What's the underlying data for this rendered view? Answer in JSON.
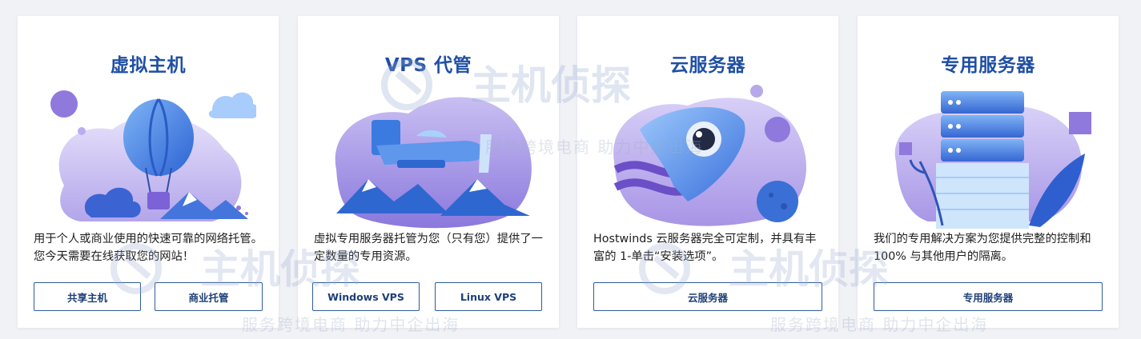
{
  "cards": [
    {
      "title": "虚拟主机",
      "description": "用于个人或商业使用的快速可靠的网络托管。 您今天需要在线获取您的网站！",
      "buttons": [
        "共享主机",
        "商业托管"
      ]
    },
    {
      "title": "VPS 代管",
      "description": "虚拟专用服务器托管为您（只有您）提供了一定数量的专用资源。",
      "buttons": [
        "Windows VPS",
        "Linux VPS"
      ]
    },
    {
      "title": "云服务器",
      "description": "Hostwinds 云服务器完全可定制，并具有丰富的 1-单击“安装选项”。",
      "buttons": [
        "云服务器"
      ]
    },
    {
      "title": "专用服务器",
      "description": "我们的专用解决方案为您提供完整的控制和 100% 与其他用户的隔离。",
      "buttons": [
        "专用服务器"
      ]
    }
  ],
  "watermark": {
    "logo_text": "主机侦探",
    "tagline": "服务跨境电商 助力中企出海"
  },
  "colors": {
    "title": "#1f4fa3",
    "button_border": "#2f5c9c",
    "illustration_purple": "#b7a8ea",
    "illustration_blue": "#3b74d8"
  }
}
